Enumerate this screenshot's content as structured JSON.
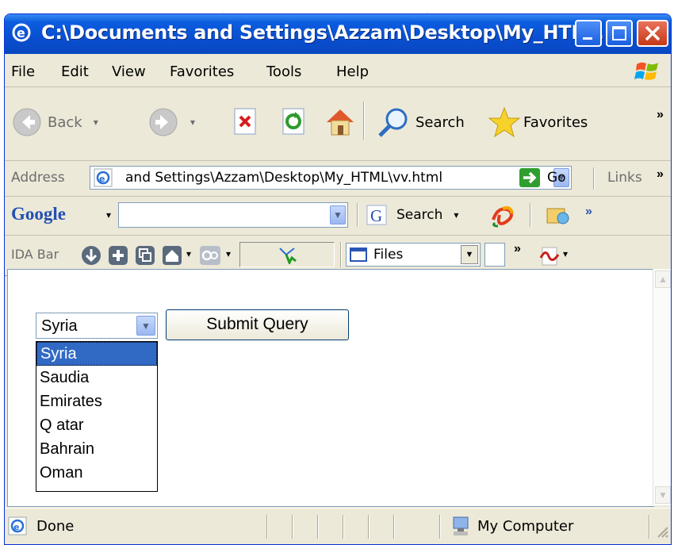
{
  "window": {
    "title": "C:\\Documents and Settings\\Azzam\\Desktop\\My_HTM..."
  },
  "menu": [
    "File",
    "Edit",
    "View",
    "Favorites",
    "Tools",
    "Help"
  ],
  "toolbar": {
    "back_label": "Back",
    "search_label": "Search",
    "favorites_label": "Favorites",
    "more": "»"
  },
  "address": {
    "label": "Address",
    "value": "and Settings\\Azzam\\Desktop\\My_HTML\\vv.html",
    "go_label": "Go",
    "links_label": "Links",
    "more": "»"
  },
  "google": {
    "logo": "Google",
    "search_label": "Search",
    "more": "»"
  },
  "ida": {
    "label": "IDA Bar",
    "files_label": "Files",
    "more": "»"
  },
  "form": {
    "selected": "Syria",
    "options": [
      "Syria",
      "Saudia",
      "Emirates",
      "Q atar",
      "Bahrain",
      "Oman"
    ],
    "submit_label": "Submit Query"
  },
  "status": {
    "text": "Done",
    "zone": "My Computer"
  },
  "colors": {
    "titlebar": "#0a4fd0",
    "selection": "#316ac5",
    "chrome": "#ece9d8"
  }
}
